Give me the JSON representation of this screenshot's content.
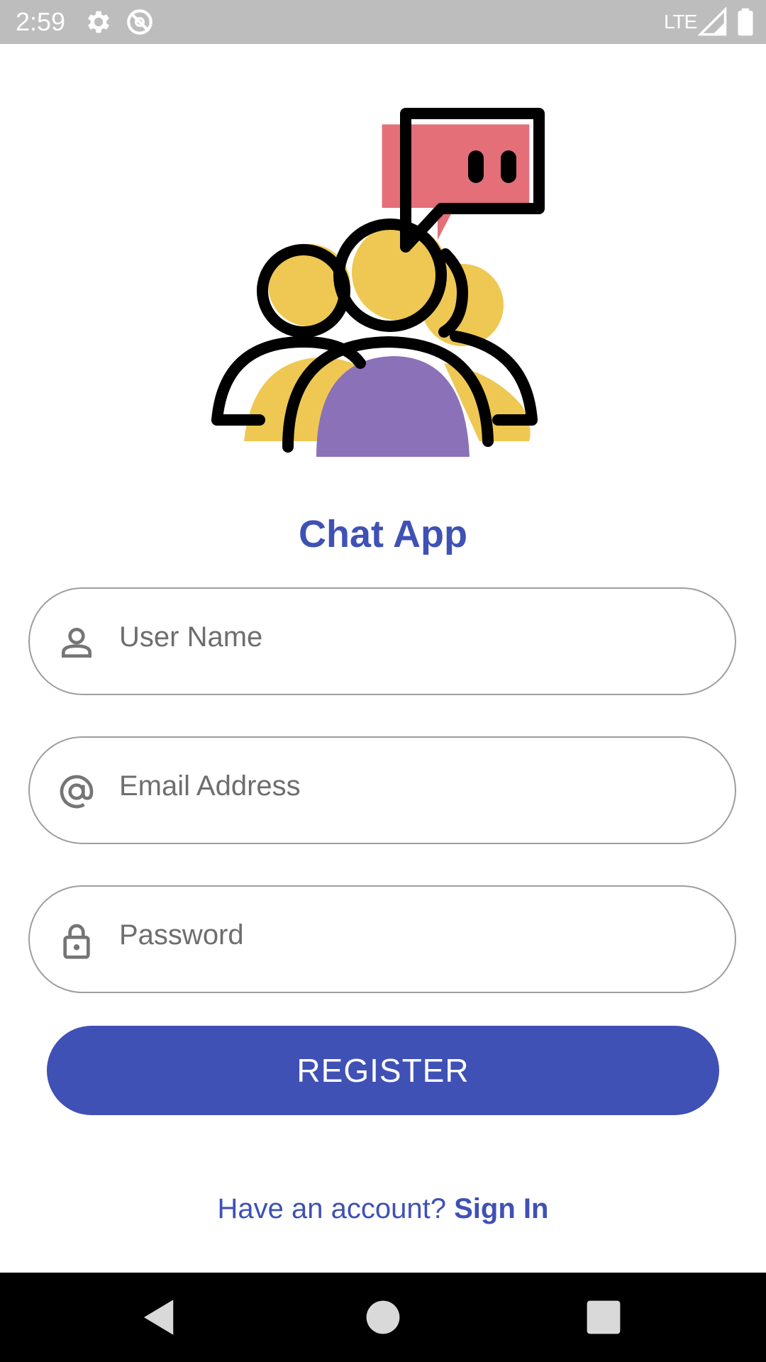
{
  "status_bar": {
    "time": "2:59",
    "network": "LTE",
    "icons": [
      "gear-icon",
      "do-not-disturb-icon",
      "signal-icon",
      "battery-icon"
    ]
  },
  "logo": {
    "icon": "group-chat-logo-icon",
    "colors": {
      "yellow": "#eec853",
      "purple": "#8b71b8",
      "pink": "#e46f79",
      "outline": "#000000"
    }
  },
  "app": {
    "title": "Chat App"
  },
  "form": {
    "username": {
      "placeholder": "User Name",
      "value": "",
      "icon": "person-icon"
    },
    "email": {
      "placeholder": "Email Address",
      "value": "",
      "icon": "at-sign-icon"
    },
    "password": {
      "placeholder": "Password",
      "value": "",
      "icon": "lock-icon"
    },
    "register_label": "REGISTER"
  },
  "footer": {
    "prompt": "Have an account? ",
    "signin_label": "Sign In"
  },
  "nav_bar": {
    "icons": [
      "back-icon",
      "home-icon",
      "recents-icon"
    ]
  },
  "colors": {
    "accent": "#3f51b5",
    "status_bar": "#bdbdbd",
    "field_border": "#9e9e9e",
    "placeholder": "#6e6e6e",
    "nav_bar": "#000000"
  }
}
